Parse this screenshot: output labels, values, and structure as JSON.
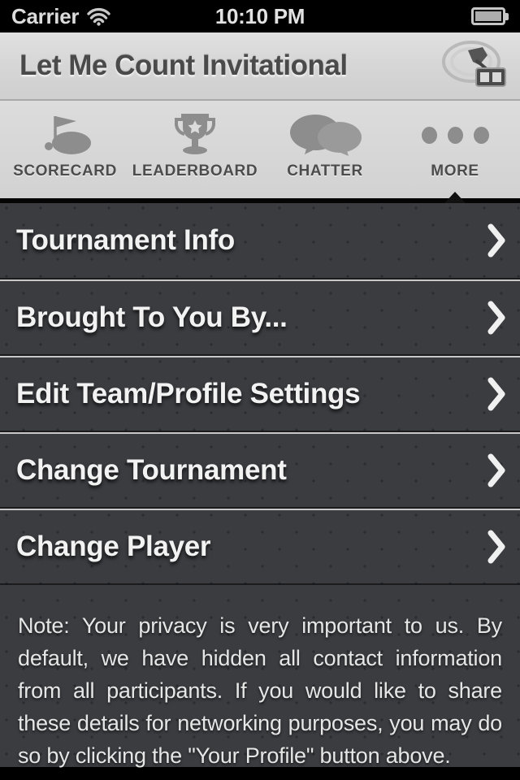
{
  "status_bar": {
    "carrier": "Carrier",
    "wifi_icon": "wifi-icon",
    "time": "10:10 PM",
    "battery_icon": "battery-icon"
  },
  "header": {
    "title": "Let Me Count Invitational",
    "logo_icon": "app-logo-icon"
  },
  "tabbar": {
    "active_tab": "MORE",
    "tabs": [
      {
        "label": "SCORECARD",
        "icon": "golf-flag-icon",
        "active": false
      },
      {
        "label": "LEADERBOARD",
        "icon": "trophy-icon",
        "active": false
      },
      {
        "label": "CHATTER",
        "icon": "speech-bubbles-icon",
        "active": false
      },
      {
        "label": "MORE",
        "icon": "ellipsis-icon",
        "active": true
      }
    ]
  },
  "menu": {
    "items": [
      {
        "label": "Tournament Info",
        "accessory_icon": "chevron-right-icon"
      },
      {
        "label": "Brought To You By...",
        "accessory_icon": "chevron-right-icon"
      },
      {
        "label": "Edit Team/Profile Settings",
        "accessory_icon": "chevron-right-icon"
      },
      {
        "label": "Change Tournament",
        "accessory_icon": "chevron-right-icon"
      },
      {
        "label": "Change Player",
        "accessory_icon": "chevron-right-icon"
      }
    ]
  },
  "note": {
    "text": "Note: Your privacy is very important to us. By default, we have hidden all contact information from all participants. If you would like to share these details for networking purposes, you may do so by clicking the \"Your Profile\" button above."
  },
  "colors": {
    "status_bar_bg": "#000000",
    "title_bar_bg": "#d8d8d8",
    "title_text": "#4a4a4a",
    "tab_bar_bg": "#d6d6d6",
    "tab_icon": "#8d8d8d",
    "tab_label": "#4c4c4c",
    "content_bg": "#3b3c40",
    "content_dot": "#2b2c30",
    "row_text": "#f2f2f2",
    "note_text": "#e6e6e6"
  }
}
